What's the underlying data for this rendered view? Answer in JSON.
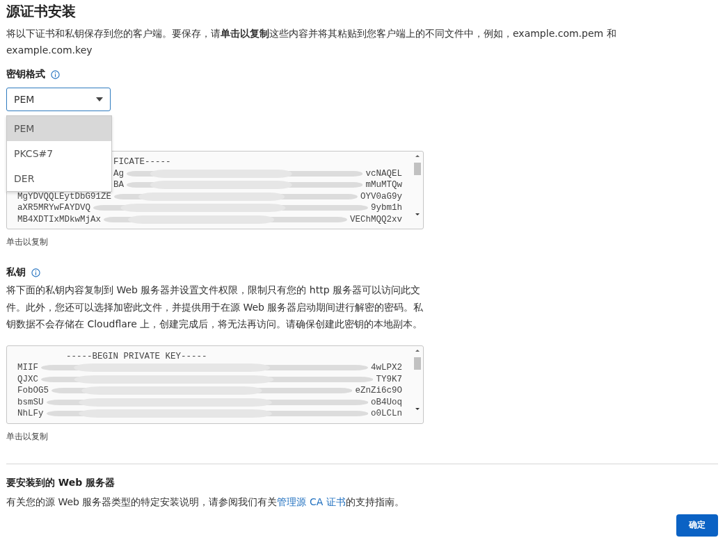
{
  "title": "源证书安装",
  "intro": "将以下证书和私钥保存到您的客户端。要保存，请**单击以复制**这些内容并将其粘贴到您客户端上的不同文件中，例如，example.com.pem 和 example.com.key",
  "key_format": {
    "label": "密钥格式",
    "value": "PEM",
    "open": true,
    "options": [
      {
        "label": "PEM",
        "selected": true
      },
      {
        "label": "PKCS#7",
        "selected": false
      },
      {
        "label": "DER",
        "selected": false
      }
    ]
  },
  "certificate": {
    "lines": [
      {
        "kind": "plain",
        "start": "FICATE-----"
      },
      {
        "kind": "redacted",
        "start": "Ag",
        "end": "vcNAQEL"
      },
      {
        "kind": "redacted",
        "start": "BA",
        "end": "mMuMTQw"
      },
      {
        "kind": "redacted",
        "start": "MgYDVQQLEytDbG91ZE",
        "end": "OYV0aG9y"
      },
      {
        "kind": "redacted",
        "start": "aXR5MRYwFAYDVQ",
        "end": "9ybm1h"
      },
      {
        "kind": "redacted",
        "start": "MB4XDTIxMDkwMjAx",
        "end": "VEChMQQ2xv"
      }
    ],
    "hint": "单击以复制"
  },
  "private_key": {
    "label": "私钥",
    "description": "将下面的私钥内容复制到 Web 服务器并设置文件权限，限制只有您的 http 服务器可以访问此文件。此外，您还可以选择加密此文件，并提供用于在源 Web 服务器启动期间进行解密的密码。私钥数据不会存储在 Cloudflare 上，创建完成后，将无法再访问。请确保创建此密钥的本地副本。",
    "lines": [
      {
        "kind": "plain",
        "start": "-----BEGIN PRIVATE KEY-----"
      },
      {
        "kind": "redacted",
        "start": "MIIF",
        "end": "4wLPX2"
      },
      {
        "kind": "redacted",
        "start": "QJXC",
        "end": "TY9K7"
      },
      {
        "kind": "redacted",
        "start": "FobOG5",
        "end": "eZnZi6c9O"
      },
      {
        "kind": "redacted",
        "start": "bsmSU",
        "end": "oB4Uoq"
      },
      {
        "kind": "redacted",
        "start": "NhLFy",
        "end": "o0LCLn"
      }
    ],
    "hint": "单击以复制"
  },
  "install": {
    "heading": "要安装到的 Web 服务器",
    "text_before": "有关您的源 Web 服务器类型的特定安装说明，请参阅我们有关",
    "link": "管理源 CA 证书",
    "text_after": "的支持指南。"
  },
  "buttons": [
    {
      "label": "确定"
    }
  ]
}
